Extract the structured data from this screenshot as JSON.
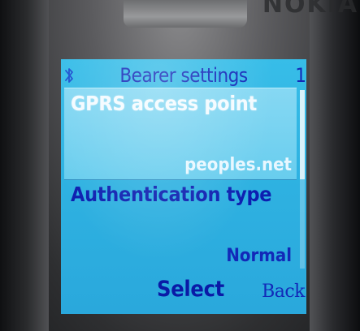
{
  "brand": {
    "logo_text": "NOKIA"
  },
  "status_bar": {
    "bluetooth_icon": "bluetooth-icon",
    "title": "Bearer settings",
    "page_number": "1"
  },
  "settings_list": [
    {
      "label": "GPRS access point",
      "value": "peoples.net",
      "selected": true
    },
    {
      "label": "Authentication type",
      "value": "Normal",
      "selected": false
    }
  ],
  "softkeys": {
    "middle": "Select",
    "right": "Back"
  },
  "colors": {
    "screen_background": "#2fb3e2",
    "selection_highlight": "#7ad4f1",
    "text_blue": "#1229b8",
    "text_white": "#f4fbff"
  }
}
